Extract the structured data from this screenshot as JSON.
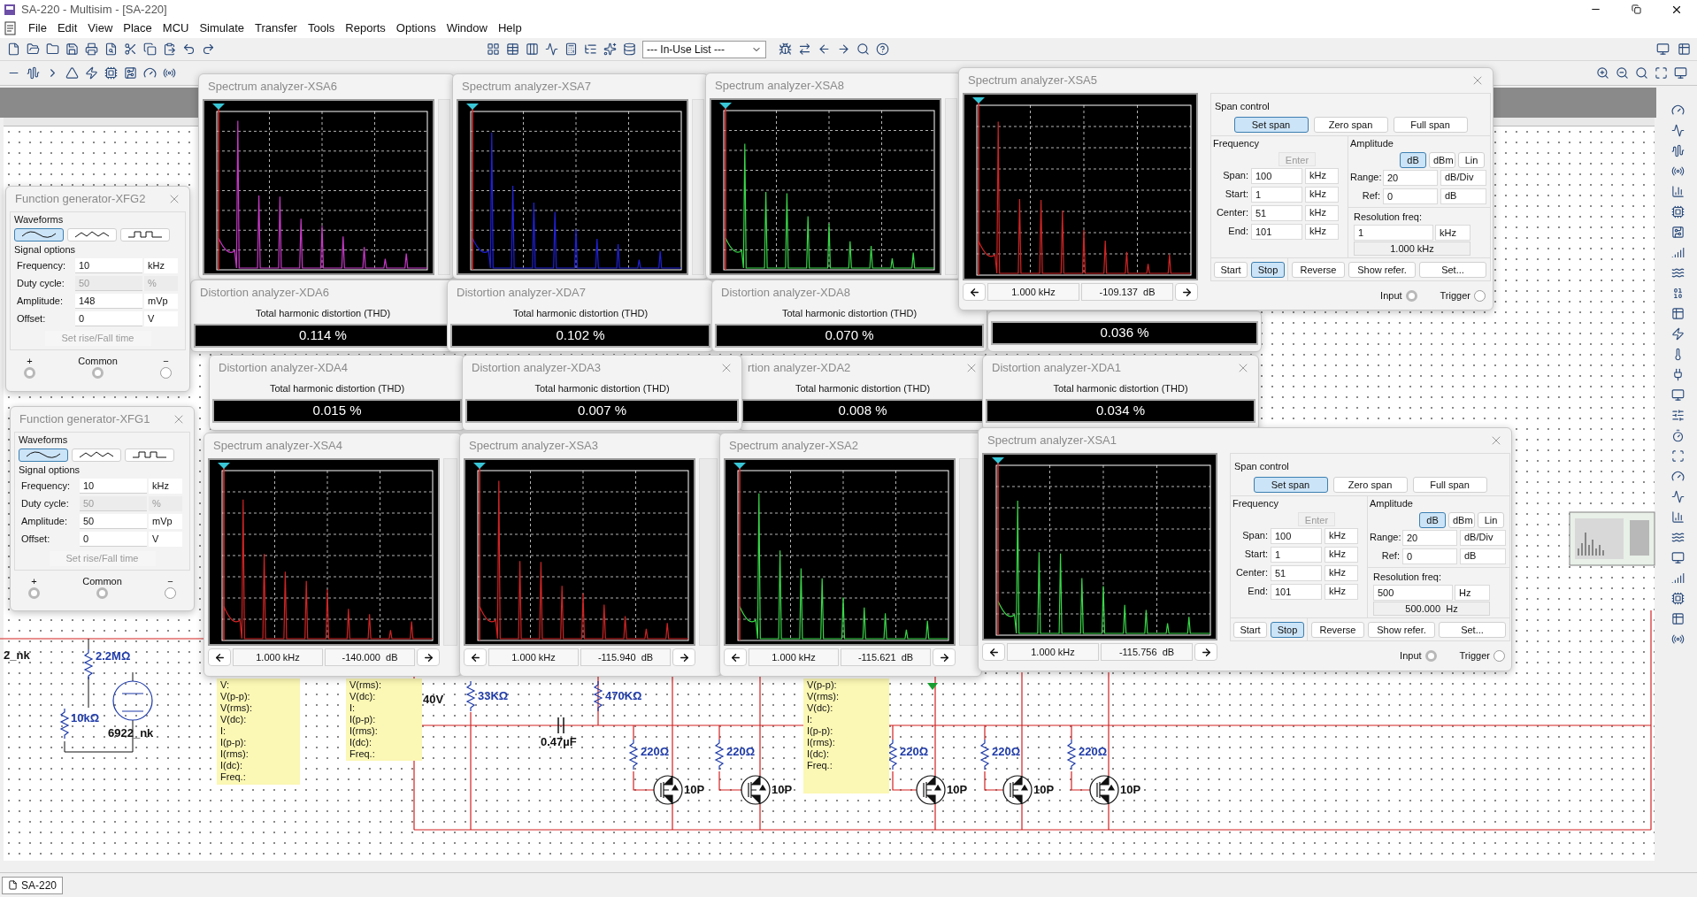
{
  "window": {
    "title": "SA-220 - Multisim - [SA-220]"
  },
  "menu": [
    "File",
    "Edit",
    "View",
    "Place",
    "MCU",
    "Simulate",
    "Transfer",
    "Tools",
    "Reports",
    "Options",
    "Window",
    "Help"
  ],
  "toolbar": {
    "in_use_list": "--- In-Use List ---"
  },
  "function_generators": [
    {
      "title": "Function generator-XFG2",
      "waveforms_label": "Waveforms",
      "waveforms": [
        {
          "kind": "sine",
          "selected": true
        },
        {
          "kind": "triangle",
          "selected": false
        },
        {
          "kind": "square",
          "selected": false
        }
      ],
      "signal_options_label": "Signal options",
      "fields": [
        {
          "label": "Frequency:",
          "value": "10",
          "unit": "kHz",
          "disabled": false
        },
        {
          "label": "Duty cycle:",
          "value": "50",
          "unit": "%",
          "disabled": true
        },
        {
          "label": "Amplitude:",
          "value": "148",
          "unit": "mVp",
          "disabled": false
        },
        {
          "label": "Offset:",
          "value": "0",
          "unit": "V",
          "disabled": false
        }
      ],
      "rise_fall_button": "Set rise/Fall time",
      "terminals": [
        {
          "label": "+",
          "connected": true
        },
        {
          "label": "Common",
          "connected": true
        },
        {
          "label": "−",
          "connected": false
        }
      ]
    },
    {
      "title": "Function generator-XFG1",
      "waveforms_label": "Waveforms",
      "waveforms": [
        {
          "kind": "sine",
          "selected": true
        },
        {
          "kind": "triangle",
          "selected": false
        },
        {
          "kind": "square",
          "selected": false
        }
      ],
      "signal_options_label": "Signal options",
      "fields": [
        {
          "label": "Frequency:",
          "value": "10",
          "unit": "kHz",
          "disabled": false
        },
        {
          "label": "Duty cycle:",
          "value": "50",
          "unit": "%",
          "disabled": true
        },
        {
          "label": "Amplitude:",
          "value": "50",
          "unit": "mVp",
          "disabled": false
        },
        {
          "label": "Offset:",
          "value": "0",
          "unit": "V",
          "disabled": false
        }
      ],
      "rise_fall_button": "Set rise/Fall time",
      "terminals": [
        {
          "label": "+",
          "connected": true
        },
        {
          "label": "Common",
          "connected": true
        },
        {
          "label": "−",
          "connected": false
        }
      ]
    }
  ],
  "spectrum_analyzers": [
    {
      "title": "Spectrum analyzer-XSA6",
      "color": "#c838c8"
    },
    {
      "title": "Spectrum analyzer-XSA7",
      "color": "#2020d8"
    },
    {
      "title": "Spectrum analyzer-XSA8",
      "color": "#38d848"
    },
    {
      "title": "Spectrum analyzer-XSA5",
      "color": "#d02424",
      "closable": true,
      "readout": {
        "frequency": "1.000 kHz",
        "amplitude": "-109.137  dB"
      },
      "controls": {
        "span_control_label": "Span control",
        "span_buttons": [
          {
            "label": "Set span",
            "selected": true
          },
          {
            "label": "Zero span",
            "selected": false
          },
          {
            "label": "Full span",
            "selected": false
          }
        ],
        "frequency_label": "Frequency",
        "enter_button": "Enter",
        "frequency_fields": [
          {
            "label": "Span:",
            "value": "100",
            "unit": "kHz"
          },
          {
            "label": "Start:",
            "value": "1",
            "unit": "kHz"
          },
          {
            "label": "Center:",
            "value": "51",
            "unit": "kHz"
          },
          {
            "label": "End:",
            "value": "101",
            "unit": "kHz"
          }
        ],
        "amplitude_label": "Amplitude",
        "amplitude_buttons": [
          {
            "label": "dB",
            "selected": true
          },
          {
            "label": "dBm",
            "selected": false
          },
          {
            "label": "Lin",
            "selected": false
          }
        ],
        "amplitude_fields": [
          {
            "label": "Range:",
            "value": "20",
            "unit": "dB/Div"
          },
          {
            "label": "Ref:",
            "value": "0",
            "unit": "dB"
          }
        ],
        "resolution_label": "Resolution freq:",
        "resolution": {
          "value": "1",
          "unit": "kHz",
          "reading": "1.000 kHz"
        },
        "run_buttons": [
          {
            "label": "Start",
            "selected": false
          },
          {
            "label": "Stop",
            "selected": true
          }
        ],
        "action_buttons": [
          "Reverse",
          "Show refer.",
          "Set..."
        ],
        "terminals": [
          {
            "label": "Input",
            "connected": true
          },
          {
            "label": "Trigger",
            "connected": false
          }
        ]
      }
    },
    {
      "title": "Spectrum analyzer-XSA4",
      "color": "#d02424",
      "readout": {
        "frequency": "1.000 kHz",
        "amplitude": "-140.000  dB"
      }
    },
    {
      "title": "Spectrum analyzer-XSA3",
      "color": "#d02424",
      "readout": {
        "frequency": "1.000 kHz",
        "amplitude": "-115.940  dB"
      }
    },
    {
      "title": "Spectrum analyzer-XSA2",
      "color": "#38d848",
      "readout": {
        "frequency": "1.000 kHz",
        "amplitude": "-115.621  dB"
      }
    },
    {
      "title": "Spectrum analyzer-XSA1",
      "color": "#38d848",
      "closable": true,
      "readout": {
        "frequency": "1.000 kHz",
        "amplitude": "-115.756  dB"
      },
      "controls": {
        "span_control_label": "Span control",
        "span_buttons": [
          {
            "label": "Set span",
            "selected": true
          },
          {
            "label": "Zero span",
            "selected": false
          },
          {
            "label": "Full span",
            "selected": false
          }
        ],
        "frequency_label": "Frequency",
        "enter_button": "Enter",
        "frequency_fields": [
          {
            "label": "Span:",
            "value": "100",
            "unit": "kHz"
          },
          {
            "label": "Start:",
            "value": "1",
            "unit": "kHz"
          },
          {
            "label": "Center:",
            "value": "51",
            "unit": "kHz"
          },
          {
            "label": "End:",
            "value": "101",
            "unit": "kHz"
          }
        ],
        "amplitude_label": "Amplitude",
        "amplitude_buttons": [
          {
            "label": "dB",
            "selected": true
          },
          {
            "label": "dBm",
            "selected": false
          },
          {
            "label": "Lin",
            "selected": false
          }
        ],
        "amplitude_fields": [
          {
            "label": "Range:",
            "value": "20",
            "unit": "dB/Div"
          },
          {
            "label": "Ref:",
            "value": "0",
            "unit": "dB"
          }
        ],
        "resolution_label": "Resolution freq:",
        "resolution": {
          "value": "500",
          "unit": "Hz",
          "reading": "500.000  Hz"
        },
        "run_buttons": [
          {
            "label": "Start",
            "selected": false
          },
          {
            "label": "Stop",
            "selected": true
          }
        ],
        "action_buttons": [
          "Reverse",
          "Show refer.",
          "Set..."
        ],
        "terminals": [
          {
            "label": "Input",
            "connected": true
          },
          {
            "label": "Trigger",
            "connected": false
          }
        ]
      }
    }
  ],
  "distortion_analyzers": [
    {
      "title": "Distortion analyzer-XDA6",
      "heading": "Total harmonic distortion (THD)",
      "value": "0.114 %"
    },
    {
      "title": "Distortion analyzer-XDA7",
      "heading": "Total harmonic distortion (THD)",
      "value": "0.102 %"
    },
    {
      "title": "Distortion analyzer-XDA8",
      "heading": "Total harmonic distortion (THD)",
      "value": "0.070 %"
    },
    {
      "value": "0.036 %"
    },
    {
      "title": "Distortion analyzer-XDA4",
      "heading": "Total harmonic distortion (THD)",
      "value": "0.015 %"
    },
    {
      "title": "Distortion analyzer-XDA3",
      "closable": true,
      "heading": "Total harmonic distortion (THD)",
      "value": "0.007 %"
    },
    {
      "title": "rtion analyzer-XDA2",
      "closable": true,
      "heading": "Total harmonic distortion (THD)",
      "value": "0.008 %"
    },
    {
      "title": "Distortion analyzer-XDA1",
      "closable": true,
      "heading": "Total harmonic distortion (THD)",
      "value": "0.034 %"
    }
  ],
  "schematic": {
    "components": [
      {
        "kind": "resistor",
        "label": "2.2MΩ"
      },
      {
        "kind": "resistor",
        "label": "10kΩ"
      },
      {
        "kind": "tube",
        "label": "6922_nk"
      },
      {
        "kind": "part_label",
        "label": "2_nk"
      },
      {
        "kind": "resistor",
        "label": "33KΩ"
      },
      {
        "kind": "resistor",
        "label": "470KΩ"
      },
      {
        "kind": "capacitor",
        "label": "0.47µF"
      },
      {
        "kind": "part_label",
        "label": "40V"
      },
      {
        "kind": "resistor",
        "label": "220Ω"
      },
      {
        "kind": "resistor",
        "label": "220Ω"
      },
      {
        "kind": "resistor",
        "label": "220Ω"
      },
      {
        "kind": "resistor",
        "label": "220Ω"
      },
      {
        "kind": "resistor",
        "label": "220Ω"
      },
      {
        "kind": "mosfet",
        "label": "10P"
      },
      {
        "kind": "mosfet",
        "label": "10P"
      },
      {
        "kind": "mosfet",
        "label": "10P"
      },
      {
        "kind": "mosfet",
        "label": "10P"
      },
      {
        "kind": "mosfet",
        "label": "10P"
      }
    ],
    "probes": [
      {
        "lines": [
          "V:",
          "V(p-p):",
          "V(rms):",
          "V(dc):",
          "I:",
          "I(p-p):",
          "I(rms):",
          "I(dc):",
          "Freq.:"
        ]
      },
      {
        "lines": [
          "V(rms):",
          "V(dc):",
          "I:",
          "I(p-p):",
          "I(rms):",
          "I(dc):",
          "Freq.:"
        ]
      },
      {
        "lines": [
          "V(p-p):",
          "V(rms):",
          "V(dc):",
          "I:",
          "I(p-p):",
          "I(rms):",
          "I(dc):",
          "Freq.:"
        ]
      }
    ]
  },
  "status_bar": {
    "tabs": [
      {
        "label": "SA-220",
        "selected": true
      }
    ]
  }
}
